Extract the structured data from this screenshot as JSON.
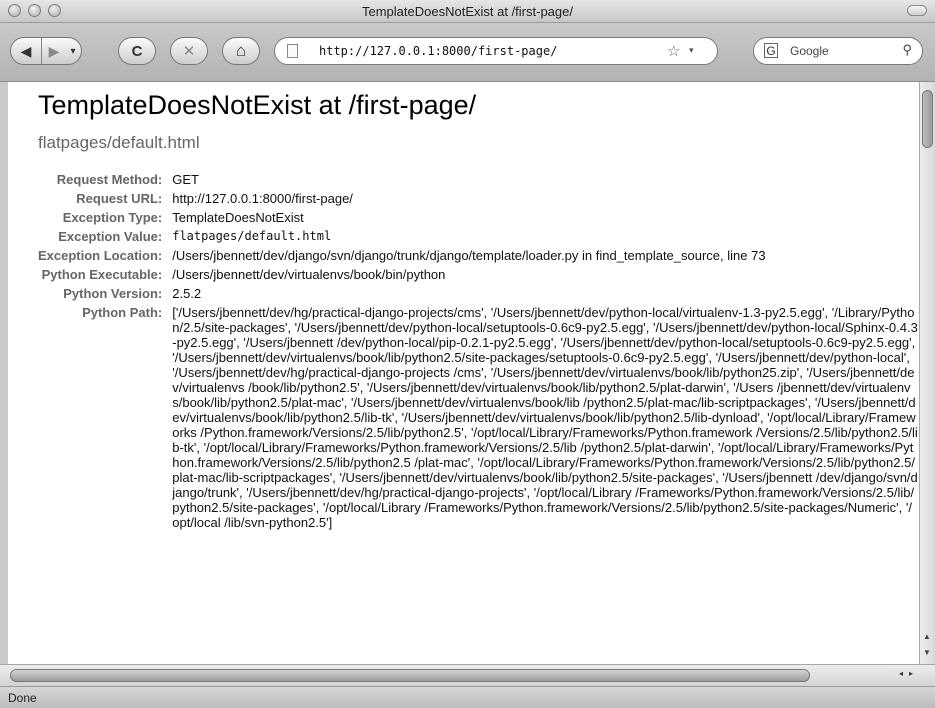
{
  "window": {
    "title": "TemplateDoesNotExist at /first-page/"
  },
  "toolbar": {
    "back_icon": "◀",
    "forward_icon": "▶",
    "forward_menu_icon": "▾",
    "reload_icon": "C",
    "stop_icon": "✕",
    "home_icon": "⌂",
    "url": "http://127.0.0.1:8000/first-page/",
    "bookmark_icon": "☆",
    "bookmark_menu_icon": "▾",
    "search_engine_icon": "G",
    "search_placeholder": "Google",
    "search_icon": "⚲"
  },
  "page": {
    "title": "TemplateDoesNotExist at /first-page/",
    "subtitle": "flatpages/default.html",
    "rows": [
      {
        "label": "Request Method:",
        "value": "GET"
      },
      {
        "label": "Request URL:",
        "value": "http://127.0.0.1:8000/first-page/"
      },
      {
        "label": "Exception Type:",
        "value": "TemplateDoesNotExist"
      },
      {
        "label": "Exception Value:",
        "value": "flatpages/default.html"
      },
      {
        "label": "Exception Location:",
        "value": "/Users/jbennett/dev/django/svn/django/trunk/django/template/loader.py in find_template_source, line 73"
      },
      {
        "label": "Python Executable:",
        "value": "/Users/jbennett/dev/virtualenvs/book/bin/python"
      },
      {
        "label": "Python Version:",
        "value": "2.5.2"
      },
      {
        "label": "Python Path:",
        "value": "['/Users/jbennett/dev/hg/practical-django-projects/cms', '/Users/jbennett/dev/python-local/virtualenv-1.3-py2.5.egg', '/Library/Python/2.5/site-packages', '/Users/jbennett/dev/python-local/setuptools-0.6c9-py2.5.egg', '/Users/jbennett/dev/python-local/Sphinx-0.4.3-py2.5.egg', '/Users/jbennett /dev/python-local/pip-0.2.1-py2.5.egg', '/Users/jbennett/dev/python-local/setuptools-0.6c9-py2.5.egg', '/Users/jbennett/dev/virtualenvs/book/lib/python2.5/site-packages/setuptools-0.6c9-py2.5.egg', '/Users/jbennett/dev/python-local', '/Users/jbennett/dev/hg/practical-django-projects /cms', '/Users/jbennett/dev/virtualenvs/book/lib/python25.zip', '/Users/jbennett/dev/virtualenvs /book/lib/python2.5', '/Users/jbennett/dev/virtualenvs/book/lib/python2.5/plat-darwin', '/Users /jbennett/dev/virtualenvs/book/lib/python2.5/plat-mac', '/Users/jbennett/dev/virtualenvs/book/lib /python2.5/plat-mac/lib-scriptpackages', '/Users/jbennett/dev/virtualenvs/book/lib/python2.5/lib-tk', '/Users/jbennett/dev/virtualenvs/book/lib/python2.5/lib-dynload', '/opt/local/Library/Frameworks /Python.framework/Versions/2.5/lib/python2.5', '/opt/local/Library/Frameworks/Python.framework /Versions/2.5/lib/python2.5/lib-tk', '/opt/local/Library/Frameworks/Python.framework/Versions/2.5/lib /python2.5/plat-darwin', '/opt/local/Library/Frameworks/Python.framework/Versions/2.5/lib/python2.5 /plat-mac', '/opt/local/Library/Frameworks/Python.framework/Versions/2.5/lib/python2.5/plat-mac/lib-scriptpackages', '/Users/jbennett/dev/virtualenvs/book/lib/python2.5/site-packages', '/Users/jbennett /dev/django/svn/django/trunk', '/Users/jbennett/dev/hg/practical-django-projects', '/opt/local/Library /Frameworks/Python.framework/Versions/2.5/lib/python2.5/site-packages', '/opt/local/Library /Frameworks/Python.framework/Versions/2.5/lib/python2.5/site-packages/Numeric', '/opt/local /lib/svn-python2.5']"
      }
    ]
  },
  "scrollbar": {
    "up_icon": "▲",
    "down_icon": "▼",
    "left_icon": "◂",
    "right_icon": "▸"
  },
  "status": {
    "text": "Done"
  }
}
